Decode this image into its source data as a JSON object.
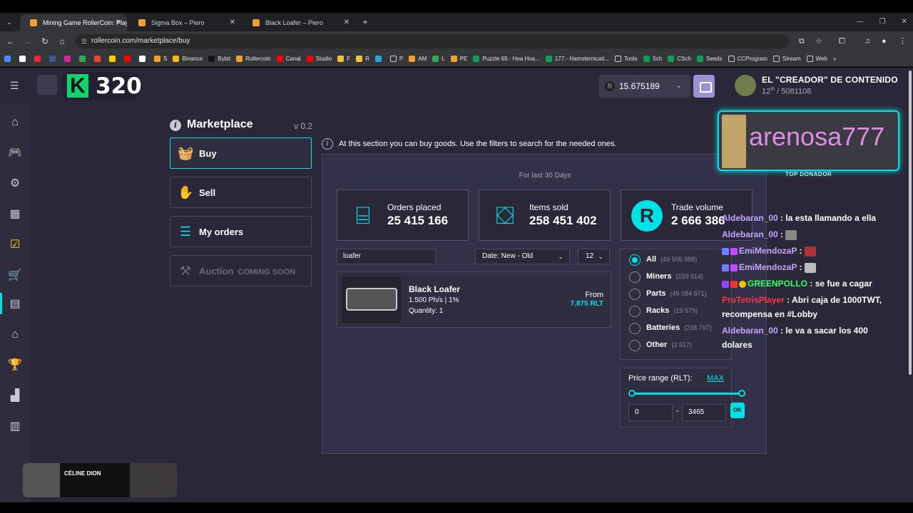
{
  "browser": {
    "tabs": [
      {
        "title": "Mining Game RollerCoin: Play N",
        "active": true
      },
      {
        "title": "Sigma Box – Piero",
        "active": false
      },
      {
        "title": "Black Loafer – Piero",
        "active": false
      }
    ],
    "url": "rollercoin.com/marketplace/buy",
    "bookmarks": [
      "S",
      "Binance",
      "Bybit",
      "Rollercoin",
      "Canal",
      "Studio",
      "F",
      "R",
      "P",
      "AM",
      "L",
      "PE",
      "Puzzle 69.- Hoa Hoa...",
      "177.- Hamsternicati...",
      "Tools",
      "Sch",
      "CSch",
      "Seeds",
      "CCProgram",
      "Stream",
      "Web"
    ]
  },
  "header": {
    "level": "320",
    "balance": "15.675189",
    "currency_symbol": "R",
    "user_name": "EL \"CREADOR\" DE CONTENIDO",
    "rank_num": "12",
    "rank_suffix": "th",
    "rank_total": "/ 5081108"
  },
  "marketplace": {
    "title": "Marketplace",
    "version": "v 0.2",
    "menu": [
      {
        "label": "Buy",
        "icon": "basket-icon",
        "active": true
      },
      {
        "label": "Sell",
        "icon": "hand-coins-icon",
        "active": false
      },
      {
        "label": "My orders",
        "icon": "list-icon",
        "active": false
      },
      {
        "label": "Auction",
        "soon": "COMING SOON",
        "icon": "gavel-icon",
        "disabled": true
      }
    ],
    "info_text": "At this section you can buy goods. Use the filters to search for the needed ones.",
    "period": "For last 30 Days",
    "stats": [
      {
        "label": "Orders placed",
        "value": "25 415 166",
        "icon": "register-icon"
      },
      {
        "label": "Items sold",
        "value": "258 451 402",
        "icon": "bags-icon"
      },
      {
        "label": "Trade volume",
        "value": "2 666 386",
        "icon": "rlt-coin-icon"
      }
    ],
    "search_value": "loafer",
    "sort_value": "Date: New - Old",
    "per_page": "12",
    "products": [
      {
        "name": "Black Loafer",
        "power": "1.500 Ph/s | 1%",
        "quantity": "Quantity: 1",
        "from_label": "From",
        "price": "7.875 RLT"
      }
    ],
    "filters": [
      {
        "label": "All",
        "count": "(49 505 988)",
        "selected": true
      },
      {
        "label": "Miners",
        "count": "(159 914)",
        "selected": false
      },
      {
        "label": "Parts",
        "count": "(49 084 871)",
        "selected": false
      },
      {
        "label": "Racks",
        "count": "(19 579)",
        "selected": false
      },
      {
        "label": "Batteries",
        "count": "(238 707)",
        "selected": false
      },
      {
        "label": "Other",
        "count": "(2 917)",
        "selected": false
      }
    ],
    "price_range": {
      "label": "Price range (RLT):",
      "max_label": "MAX",
      "min": "0",
      "max": "3465",
      "ok_label": "OK"
    }
  },
  "overlay": {
    "donor_name": "arenosa777",
    "donor_tag": "TOP DONADOR",
    "chat": [
      {
        "user": "Aldebaran_00",
        "text": ": la esta llamando a ella",
        "color": "purple"
      },
      {
        "user": "Aldebaran_00",
        "text": ":",
        "color": "purple",
        "emote": true
      },
      {
        "user": "EmiMendozaP",
        "text": ":",
        "color": "purple",
        "emote": true
      },
      {
        "user": "EmiMendozaP",
        "text": ":",
        "color": "purple",
        "emote": true
      },
      {
        "user": "GREENPOLLO",
        "text": ": se fue a cagar",
        "color": "green"
      },
      {
        "user": "ProTetrisPlayer",
        "text": ": Abri caja de 1000TWT, recompensa en #Lobby",
        "color": "red"
      },
      {
        "user": "Aldebaran_00",
        "text": ": le va a sacar los 400 dolares",
        "color": "purple"
      }
    ],
    "music_artist": "CÉLINE DION"
  }
}
